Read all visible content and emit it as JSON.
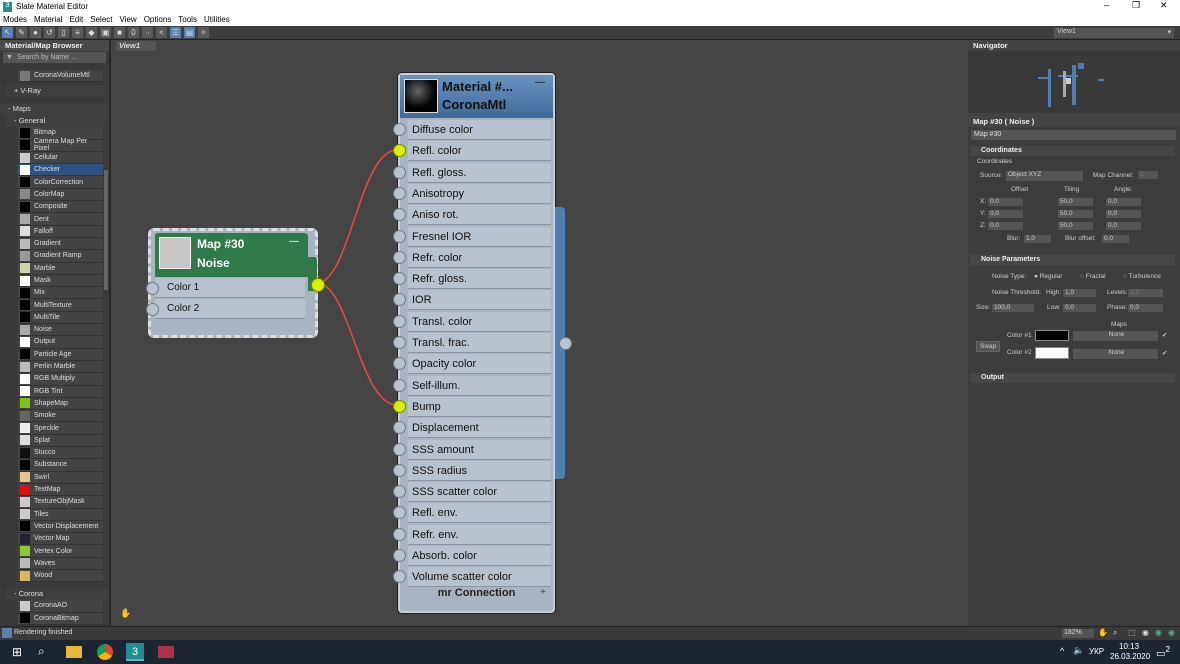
{
  "window": {
    "title": "Slate Material Editor",
    "logo": "3"
  },
  "menu": [
    "Modes",
    "Material",
    "Edit",
    "Select",
    "View",
    "Options",
    "Tools",
    "Utilities"
  ],
  "toolbar": {
    "view_select": "View1"
  },
  "browser": {
    "title": "Material/Map Browser",
    "search_placeholder": "Search by Name ...",
    "prev_item": "CoronaVolumeMtl",
    "vray_group": "+ V-Ray",
    "maps_group": "- Maps",
    "general_group": "- General",
    "general_items": [
      {
        "label": "Bitmap",
        "color": "#000"
      },
      {
        "label": "Camera Map Per Pixel",
        "color": "#000"
      },
      {
        "label": "Cellular",
        "color": "#ccc"
      },
      {
        "label": "Checker",
        "color": "#fff",
        "selected": true
      },
      {
        "label": "ColorCorrection",
        "color": "#000"
      },
      {
        "label": "ColorMap",
        "color": "#888"
      },
      {
        "label": "Composite",
        "color": "#000"
      },
      {
        "label": "Dent",
        "color": "#aaa"
      },
      {
        "label": "Falloff",
        "color": "#ddd"
      },
      {
        "label": "Gradient",
        "color": "#bbb"
      },
      {
        "label": "Gradient Ramp",
        "color": "#999"
      },
      {
        "label": "Marble",
        "color": "#cdd4a8"
      },
      {
        "label": "Mask",
        "color": "#fff"
      },
      {
        "label": "Mix",
        "color": "#000"
      },
      {
        "label": "MultiTexture",
        "color": "#000"
      },
      {
        "label": "MultiTile",
        "color": "#000"
      },
      {
        "label": "Noise",
        "color": "#aaa"
      },
      {
        "label": "Output",
        "color": "#fff"
      },
      {
        "label": "Particle Age",
        "color": "#000"
      },
      {
        "label": "Perlin Marble",
        "color": "#bbb"
      },
      {
        "label": "RGB Multiply",
        "color": "#fff"
      },
      {
        "label": "RGB Tint",
        "color": "#fff"
      },
      {
        "label": "ShapeMap",
        "color": "#7cc21e"
      },
      {
        "label": "Smoke",
        "color": "#666"
      },
      {
        "label": "Speckle",
        "color": "#eee"
      },
      {
        "label": "Splat",
        "color": "#ddd"
      },
      {
        "label": "Stucco",
        "color": "#111"
      },
      {
        "label": "Substance",
        "color": "#000"
      },
      {
        "label": "Swirl",
        "color": "#e7c48f"
      },
      {
        "label": "TextMap",
        "color": "#e01010"
      },
      {
        "label": "TextureObjMask",
        "color": "#ccc"
      },
      {
        "label": "Tiles",
        "color": "#ccc"
      },
      {
        "label": "Vector Displacement",
        "color": "#000"
      },
      {
        "label": "Vector Map",
        "color": "#223"
      },
      {
        "label": "Vertex Color",
        "color": "#8c3"
      },
      {
        "label": "Waves",
        "color": "#bbb"
      },
      {
        "label": "Wood",
        "color": "#d8b860"
      }
    ],
    "corona_group": "- Corona",
    "corona_items": [
      {
        "label": "CoronaAO",
        "color": "#ccc"
      },
      {
        "label": "CoronaBitmap",
        "color": "#000"
      }
    ]
  },
  "view": {
    "tab": "View1"
  },
  "material_node": {
    "title": "Material #...",
    "subtitle": "CoronaMtl",
    "collapse": "—",
    "footer": "mr Connection",
    "footer_plus": "+",
    "slots": [
      "Diffuse color",
      "Refl. color",
      "Refl. gloss.",
      "Anisotropy",
      "Aniso rot.",
      "Fresnel IOR",
      "Refr. color",
      "Refr. gloss.",
      "IOR",
      "Transl. color",
      "Transl. frac.",
      "Opacity color",
      "Self-illum.",
      "Bump",
      "Displacement",
      "SSS amount",
      "SSS radius",
      "SSS scatter color",
      "Refl. env.",
      "Refr. env.",
      "Absorb. color",
      "Volume scatter color"
    ],
    "connected": [
      "Refl. color",
      "Bump"
    ]
  },
  "noise_node": {
    "title": "Map #30",
    "subtitle": "Noise",
    "collapse": "—",
    "slots": [
      "Color 1",
      "Color 2"
    ]
  },
  "navigator": {
    "title": "Navigator"
  },
  "props": {
    "title": "Map #30  ( Noise )",
    "name_value": "Map #30",
    "coordinates": {
      "section": "Coordinates",
      "group": "Coordinates",
      "source_label": "Source:",
      "source_value": "Object XYZ",
      "map_channel_label": "Map Channel:",
      "map_channel_value": "1",
      "offset": "Offset",
      "tiling": "Tiling",
      "angle": "Angle:",
      "rows": [
        {
          "axis": "X:",
          "offset": "0,0",
          "tiling": "50,0",
          "angle": "0,0"
        },
        {
          "axis": "Y:",
          "offset": "0,0",
          "tiling": "50,0",
          "angle": "0,0"
        },
        {
          "axis": "Z:",
          "offset": "0,0",
          "tiling": "50,0",
          "angle": "0,0"
        }
      ],
      "blur_label": "Blur:",
      "blur": "1,0",
      "blur_offset_label": "Blur offset:",
      "blur_offset": "0,0"
    },
    "noise": {
      "section": "Noise Parameters",
      "type_label": "Noise Type:",
      "types": [
        "Regular",
        "Fractal",
        "Turbulence"
      ],
      "threshold_label": "Noise Threshold:",
      "high_label": "High:",
      "high": "1,0",
      "levels_label": "Levels:",
      "levels": "3,0",
      "size_label": "Size:",
      "size": "100,0",
      "low_label": "Low:",
      "low": "0,0",
      "phase_label": "Phase:",
      "phase": "0,0",
      "maps_label": "Maps",
      "swap": "Swap",
      "color1_label": "Color #1",
      "color1": "#000000",
      "color2_label": "Color #2",
      "color2": "#ffffff",
      "map1": "None",
      "map2": "None"
    },
    "output": {
      "section": "Output"
    }
  },
  "status": {
    "text": "Rendering finished",
    "zoom": "182%"
  },
  "taskbar": {
    "lang": "УКР",
    "time": "10:13",
    "date": "26.03.2020",
    "notifications": "2"
  }
}
